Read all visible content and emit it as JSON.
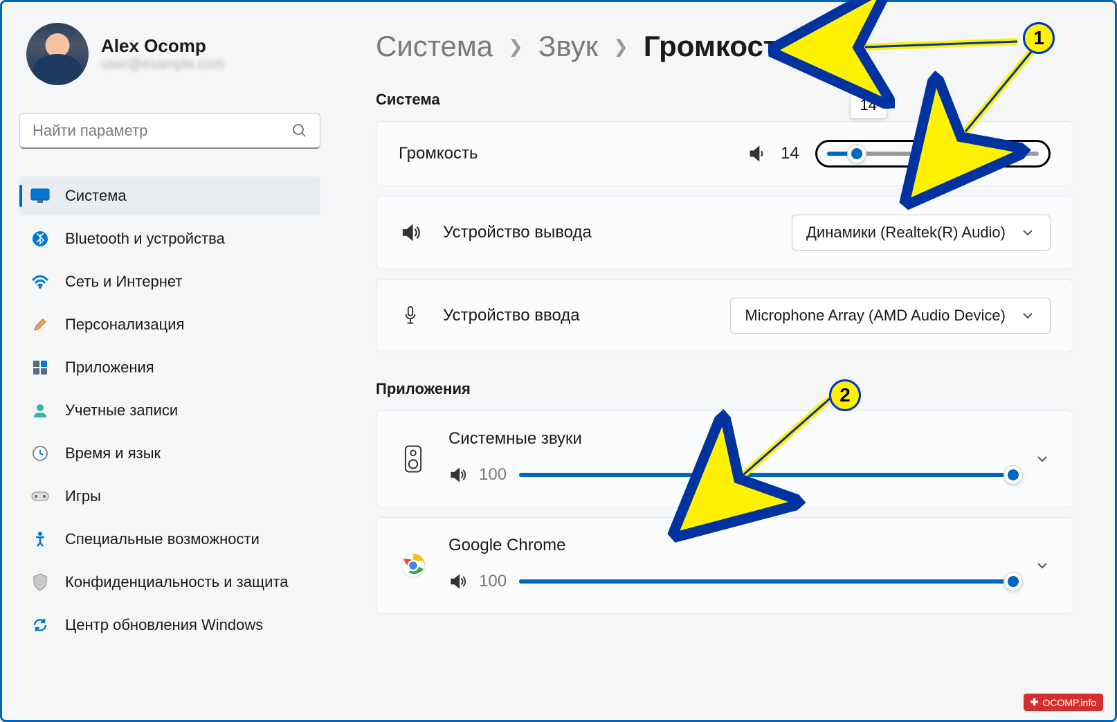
{
  "user": {
    "name": "Alex Ocomp",
    "subtitle": "user@example.com"
  },
  "search": {
    "placeholder": "Найти параметр"
  },
  "nav": {
    "items": [
      {
        "label": "Система"
      },
      {
        "label": "Bluetooth и устройства"
      },
      {
        "label": "Сеть и Интернет"
      },
      {
        "label": "Персонализация"
      },
      {
        "label": "Приложения"
      },
      {
        "label": "Учетные записи"
      },
      {
        "label": "Время и язык"
      },
      {
        "label": "Игры"
      },
      {
        "label": "Специальные возможности"
      },
      {
        "label": "Конфиденциальность и защита"
      },
      {
        "label": "Центр обновления Windows"
      }
    ]
  },
  "breadcrumb": {
    "l1": "Система",
    "l2": "Звук",
    "current": "Громкость"
  },
  "sections": {
    "system": "Система",
    "apps": "Приложения"
  },
  "volume": {
    "label": "Громкость",
    "value": "14",
    "tooltip": "14"
  },
  "output": {
    "label": "Устройство вывода",
    "value": "Динамики (Realtek(R) Audio)"
  },
  "input": {
    "label": "Устройство ввода",
    "value": "Microphone Array (AMD Audio Device)"
  },
  "apps": [
    {
      "name": "Системные звуки",
      "value": "100"
    },
    {
      "name": "Google Chrome",
      "value": "100"
    }
  ],
  "annotations": {
    "badge1": "1",
    "badge2": "2"
  },
  "watermark": "OCOMP.info"
}
